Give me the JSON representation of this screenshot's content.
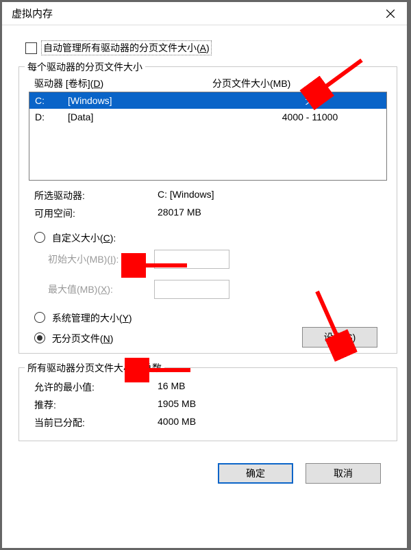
{
  "window": {
    "title": "虚拟内存"
  },
  "autoManage": {
    "checked": false,
    "label_pre": "自动管理所有驱动器的分页文件大小(",
    "hotkey": "A",
    "label_post": ")"
  },
  "drivesGroup": {
    "legend": "每个驱动器的分页文件大小",
    "header_drive_pre": "驱动器 [卷标](",
    "header_drive_hotkey": "D",
    "header_drive_post": ")",
    "header_size": "分页文件大小(MB)",
    "rows": [
      {
        "letter": "C:",
        "label": "[Windows]",
        "size": "无",
        "selected": true
      },
      {
        "letter": "D:",
        "label": "[Data]",
        "size": "4000 - 11000",
        "selected": false
      }
    ]
  },
  "selected": {
    "drive_label": "所选驱动器:",
    "drive_value": "C:  [Windows]",
    "free_label": "可用空间:",
    "free_value": "28017 MB"
  },
  "custom": {
    "label_pre": "自定义大小(",
    "hotkey": "C",
    "label_post": "):",
    "initial_label_pre": "初始大小(MB)(",
    "initial_hotkey": "I",
    "initial_label_post": "):",
    "max_label_pre": "最大值(MB)(",
    "max_hotkey": "X",
    "max_label_post": "):"
  },
  "system": {
    "label_pre": "系统管理的大小(",
    "hotkey": "Y",
    "label_post": ")"
  },
  "nopage": {
    "label_pre": "无分页文件(",
    "hotkey": "N",
    "label_post": ")"
  },
  "setbtn": {
    "label_pre": "设置(",
    "hotkey": "S",
    "label_post": ")"
  },
  "totals": {
    "legend": "所有驱动器分页文件大小的总数",
    "min_label": "允许的最小值:",
    "min_value": "16 MB",
    "rec_label": "推荐:",
    "rec_value": "1905 MB",
    "cur_label": "当前已分配:",
    "cur_value": "4000 MB"
  },
  "buttons": {
    "ok": "确定",
    "cancel": "取消"
  }
}
